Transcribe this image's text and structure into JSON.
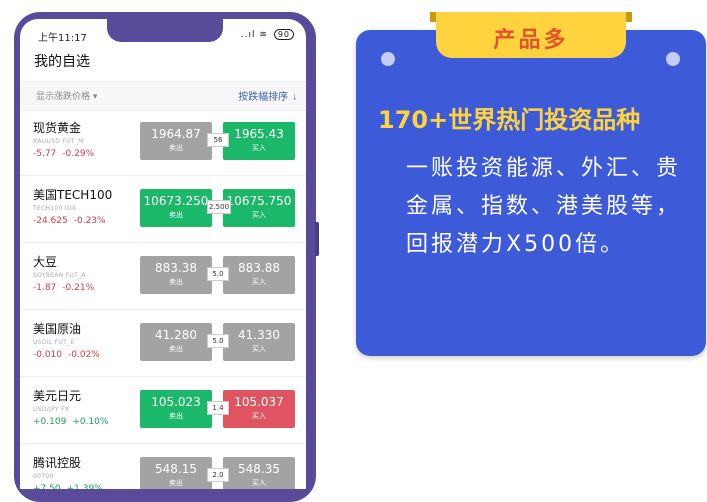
{
  "status_bar": {
    "time": "上午11:17",
    "signal": "..ıl",
    "battery": "90"
  },
  "page_title": "我的自选",
  "filter": {
    "left_label": "显示涨跌价格",
    "right_label": "按跌幅排序"
  },
  "rows": [
    {
      "name": "现货黄金",
      "code": "XAUUSD  FUT_M",
      "change": "-5.77",
      "change_pct": "-0.29%",
      "direction": "down",
      "sell_price": "1964.87",
      "sell_label": "卖出",
      "sell_color": "gray",
      "spread": "56",
      "buy_price": "1965.43",
      "buy_label": "买入",
      "buy_color": "green"
    },
    {
      "name": "美国TECH100",
      "code": "TECH100  IDX",
      "change": "-24.625",
      "change_pct": "-0.23%",
      "direction": "down",
      "sell_price": "10673.250",
      "sell_label": "卖出",
      "sell_color": "green",
      "spread": "2.500",
      "buy_price": "10675.750",
      "buy_label": "买入",
      "buy_color": "green"
    },
    {
      "name": "大豆",
      "code": "SOYBEAN  FUT_A",
      "change": "-1.87",
      "change_pct": "-0.21%",
      "direction": "down",
      "sell_price": "883.38",
      "sell_label": "卖出",
      "sell_color": "gray",
      "spread": "5.0",
      "buy_price": "883.88",
      "buy_label": "买入",
      "buy_color": "gray"
    },
    {
      "name": "美国原油",
      "code": "USOIL  FUT_E",
      "change": "-0.010",
      "change_pct": "-0.02%",
      "direction": "down",
      "sell_price": "41.280",
      "sell_label": "卖出",
      "sell_color": "gray",
      "spread": "5.0",
      "buy_price": "41.330",
      "buy_label": "买入",
      "buy_color": "gray"
    },
    {
      "name": "美元日元",
      "code": "USD/JPY  FX",
      "change": "+0.109",
      "change_pct": "+0.10%",
      "direction": "up",
      "sell_price": "105.023",
      "sell_label": "卖出",
      "sell_color": "green",
      "spread": "1.4",
      "buy_price": "105.037",
      "buy_label": "买入",
      "buy_color": "red"
    },
    {
      "name": "腾讯控股",
      "code": "00700",
      "change": "+7.50",
      "change_pct": "+1.39%",
      "direction": "up",
      "sell_price": "548.15",
      "sell_label": "卖出",
      "sell_color": "gray",
      "spread": "2.0",
      "buy_price": "548.35",
      "buy_label": "买入",
      "buy_color": "gray"
    }
  ],
  "colors": {
    "purple_frame": "#5a4a9a",
    "promo_blue": "#3d5ad9",
    "promo_yellow": "#ffd33d",
    "gray": "#a3a3a3",
    "green": "#1cb86a",
    "red": "#e05461"
  },
  "promo": {
    "tab_label": "产品多",
    "headline": "170+世界热门投资品种",
    "body": "一账投资能源、外汇、贵金属、指数、港美股等，回报潜力X500倍。"
  }
}
